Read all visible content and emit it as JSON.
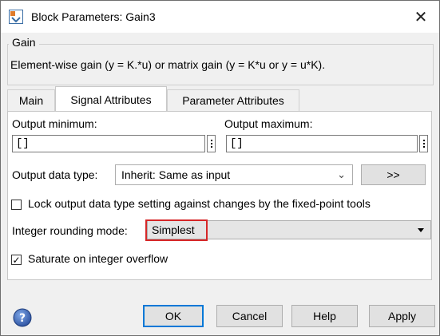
{
  "window": {
    "title": "Block Parameters: Gain3",
    "close_glyph": "✕"
  },
  "gain_group": {
    "legend": "Gain",
    "description": "Element-wise gain (y = K.*u) or matrix gain (y = K*u or y = u*K)."
  },
  "tabs": [
    {
      "label": "Main",
      "active": false
    },
    {
      "label": "Signal Attributes",
      "active": true
    },
    {
      "label": "Parameter Attributes",
      "active": false
    }
  ],
  "signal_attributes": {
    "output_minimum": {
      "label": "Output minimum:",
      "value": "[]"
    },
    "output_maximum": {
      "label": "Output maximum:",
      "value": "[]"
    },
    "output_data_type": {
      "label": "Output data type:",
      "value": "Inherit: Same as input",
      "assistant_button": ">>"
    },
    "lock_output": {
      "label": "Lock output data type setting against changes by the fixed-point tools",
      "checked": false
    },
    "rounding_mode": {
      "label": "Integer rounding mode:",
      "value": "Simplest"
    },
    "saturate": {
      "label": "Saturate on integer overflow",
      "checked": true,
      "check_glyph": "✓"
    }
  },
  "footer": {
    "ok": "OK",
    "cancel": "Cancel",
    "help": "Help",
    "apply": "Apply"
  },
  "icons": {
    "help": "help-circle-icon",
    "app": "simulink-block-icon"
  },
  "colors": {
    "highlight": "#d62728",
    "default_button_border": "#0078d7"
  }
}
